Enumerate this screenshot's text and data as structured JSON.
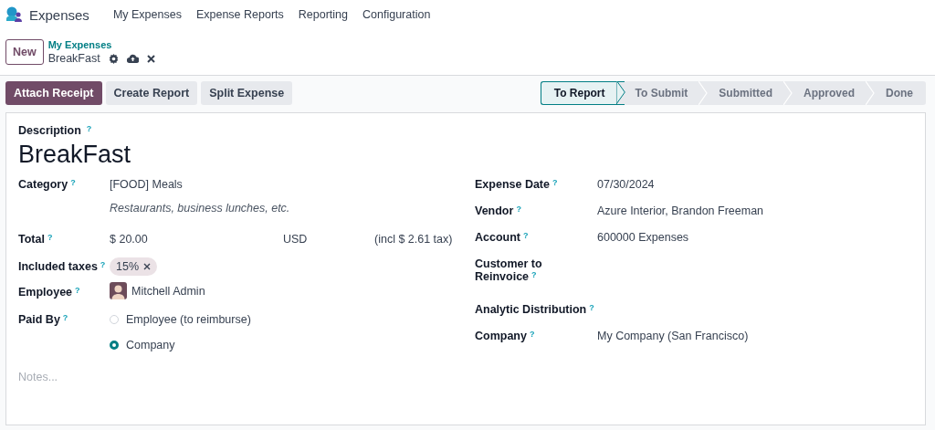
{
  "app": {
    "name": "Expenses",
    "menu": [
      "My Expenses",
      "Expense Reports",
      "Reporting",
      "Configuration"
    ]
  },
  "control_panel": {
    "new_button": "New",
    "breadcrumb": "My Expenses",
    "record": "BreakFast"
  },
  "actions": [
    {
      "label": "Attach Receipt",
      "primary": true
    },
    {
      "label": "Create Report",
      "primary": false
    },
    {
      "label": "Split Expense",
      "primary": false
    }
  ],
  "statusbar": [
    {
      "label": "To Report",
      "selected": true
    },
    {
      "label": "To Submit",
      "selected": false
    },
    {
      "label": "Submitted",
      "selected": false
    },
    {
      "label": "Approved",
      "selected": false
    },
    {
      "label": "Done",
      "selected": false
    }
  ],
  "form": {
    "description_label": "Description",
    "description_help": "?",
    "title": "BreakFast",
    "left": [
      {
        "kind": "text",
        "label": "Category",
        "help": "?",
        "value": "[FOOD] Meals",
        "note": "Restaurants, business lunches, etc."
      },
      {
        "kind": "amount",
        "label": "Total",
        "help": "?",
        "value": "$ 20.00",
        "currency": "USD",
        "tax": "(incl $ 2.61 tax)"
      },
      {
        "kind": "tags",
        "label": "Included taxes",
        "help": "?",
        "tags": [
          "15%"
        ]
      },
      {
        "kind": "avatar",
        "label": "Employee",
        "help": "?",
        "value": "Mitchell Admin"
      },
      {
        "kind": "radio",
        "label": "Paid By",
        "help": "?",
        "options": [
          {
            "label": "Employee (to reimburse)",
            "selected": false
          },
          {
            "label": "Company",
            "selected": true
          }
        ]
      }
    ],
    "right": [
      {
        "kind": "text",
        "label": "Expense Date",
        "help": "?",
        "value": "07/30/2024"
      },
      {
        "kind": "text",
        "label": "Vendor",
        "help": "?",
        "value": "Azure Interior, Brandon Freeman"
      },
      {
        "kind": "text",
        "label": "Account",
        "help": "?",
        "value": "600000 Expenses"
      },
      {
        "kind": "text",
        "label": "Customer to Reinvoice",
        "help": "?"
      },
      {
        "kind": "text",
        "label": "Analytic Distribution",
        "help": "?"
      },
      {
        "kind": "text",
        "label": "Company",
        "help": "?",
        "value": "My Company (San Francisco)"
      }
    ],
    "notes_placeholder": "Notes..."
  }
}
